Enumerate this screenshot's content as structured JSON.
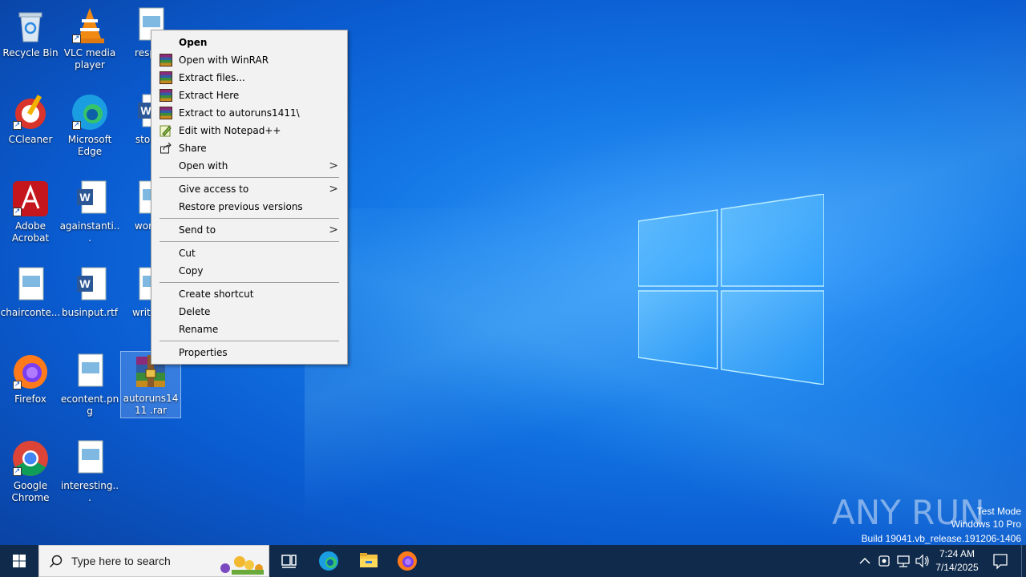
{
  "desktop": {
    "icons": [
      {
        "label": "Recycle Bin"
      },
      {
        "label": "VLC media player"
      },
      {
        "label": "respec"
      },
      {
        "label": "CCleaner"
      },
      {
        "label": "Microsoft Edge"
      },
      {
        "label": "storag"
      },
      {
        "label": "Adobe Acrobat"
      },
      {
        "label": "againstanti..."
      },
      {
        "label": "worldv"
      },
      {
        "label": "chairconte..."
      },
      {
        "label": "businput.rtf"
      },
      {
        "label": "writerin"
      },
      {
        "label": "Firefox"
      },
      {
        "label": "econtent.png"
      },
      {
        "label": "autoruns1411 .rar"
      },
      {
        "label": "Google Chrome"
      },
      {
        "label": "interesting..."
      }
    ]
  },
  "context_menu": {
    "items": [
      {
        "label": "Open"
      },
      {
        "label": "Open with WinRAR"
      },
      {
        "label": "Extract files..."
      },
      {
        "label": "Extract Here"
      },
      {
        "label": "Extract to autoruns1411\\"
      },
      {
        "label": "Edit with Notepad++"
      },
      {
        "label": "Share"
      },
      {
        "label": "Open with"
      },
      {
        "label": "Give access to"
      },
      {
        "label": "Restore previous versions"
      },
      {
        "label": "Send to"
      },
      {
        "label": "Cut"
      },
      {
        "label": "Copy"
      },
      {
        "label": "Create shortcut"
      },
      {
        "label": "Delete"
      },
      {
        "label": "Rename"
      },
      {
        "label": "Properties"
      }
    ],
    "submenu_arrow": ">"
  },
  "watermark": {
    "line1": "Test Mode",
    "line2": "Windows 10 Pro",
    "line3": "Build 19041.vb_release.191206-1406",
    "brand": "ANY RUN"
  },
  "taskbar": {
    "search_placeholder": "Type here to search",
    "time": "7:24 AM",
    "date": "7/14/2025"
  },
  "colors": {
    "taskbar": "#0f2a4a",
    "menu_bg": "#f2f2f2",
    "desktop_accent": "#1478e6"
  }
}
